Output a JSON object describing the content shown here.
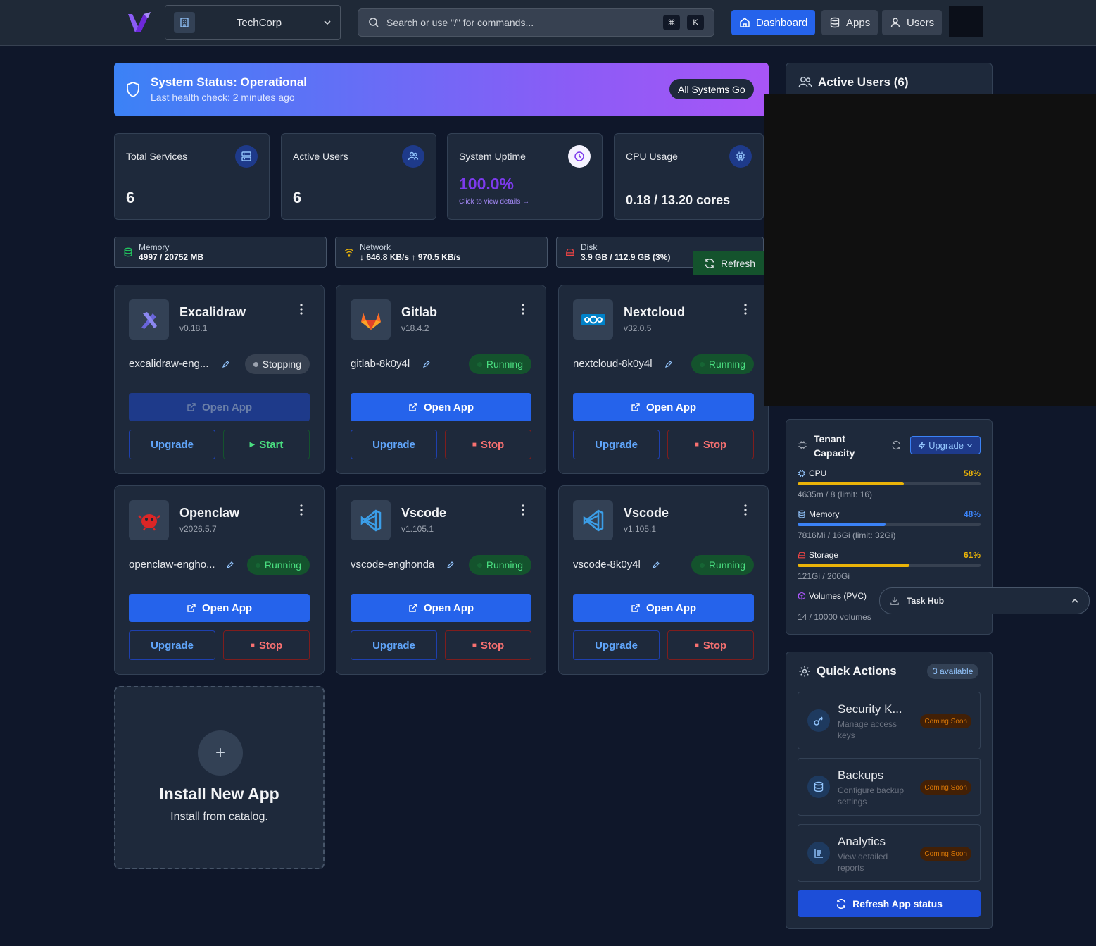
{
  "header": {
    "org_name": "TechCorp",
    "search_placeholder": "Search or use \"/\" for commands...",
    "shortcut_keys": [
      "⌘",
      "K"
    ],
    "nav": [
      {
        "label": "Dashboard",
        "icon": "home-icon",
        "active": true
      },
      {
        "label": "Apps",
        "icon": "database-icon",
        "active": false
      },
      {
        "label": "Users",
        "icon": "user-icon",
        "active": false
      }
    ]
  },
  "status_banner": {
    "title": "System Status: Operational",
    "subtitle": "Last health check: 2 minutes ago",
    "pill": "All Systems Go"
  },
  "stats": [
    {
      "label": "Total Services",
      "value": "6",
      "icon": "server-icon"
    },
    {
      "label": "Active Users",
      "value": "6",
      "icon": "users-icon"
    },
    {
      "label": "System Uptime",
      "value": "100.0%",
      "link": "Click to view details →",
      "icon": "clock-icon"
    },
    {
      "label": "CPU Usage",
      "value": "0.18 / 13.20 cores",
      "icon": "cpu-icon"
    }
  ],
  "metrics": [
    {
      "label": "Memory",
      "value": "4997 / 20752 MB",
      "icon": "memory-icon",
      "color": "#22c55e"
    },
    {
      "label": "Network",
      "value": "↓ 646.8 KB/s ↑ 970.5 KB/s",
      "icon": "wifi-icon",
      "color": "#eab308"
    },
    {
      "label": "Disk",
      "value": "3.9 GB / 112.9 GB (3%)",
      "icon": "disk-icon",
      "color": "#ef4444"
    }
  ],
  "refresh_label": "Refresh",
  "apps": [
    {
      "name": "Excalidraw",
      "version": "v0.18.1",
      "instance": "excalidraw-eng...",
      "status": "Stopping",
      "open_label": "Open App",
      "upgrade_label": "Upgrade",
      "action_label": "Start",
      "logo": "excalidraw-logo-icon"
    },
    {
      "name": "Gitlab",
      "version": "v18.4.2",
      "instance": "gitlab-8k0y4l",
      "status": "Running",
      "open_label": "Open App",
      "upgrade_label": "Upgrade",
      "action_label": "Stop",
      "logo": "gitlab-logo-icon"
    },
    {
      "name": "Nextcloud",
      "version": "v32.0.5",
      "instance": "nextcloud-8k0y4l",
      "status": "Running",
      "open_label": "Open App",
      "upgrade_label": "Upgrade",
      "action_label": "Stop",
      "logo": "nextcloud-logo-icon"
    },
    {
      "name": "Openclaw",
      "version": "v2026.5.7",
      "instance": "openclaw-engho...",
      "status": "Running",
      "open_label": "Open App",
      "upgrade_label": "Upgrade",
      "action_label": "Stop",
      "logo": "openclaw-logo-icon"
    },
    {
      "name": "Vscode",
      "version": "v1.105.1",
      "instance": "vscode-enghonda",
      "status": "Running",
      "open_label": "Open App",
      "upgrade_label": "Upgrade",
      "action_label": "Stop",
      "logo": "vscode-logo-icon"
    },
    {
      "name": "Vscode",
      "version": "v1.105.1",
      "instance": "vscode-8k0y4l",
      "status": "Running",
      "open_label": "Open App",
      "upgrade_label": "Upgrade",
      "action_label": "Stop",
      "logo": "vscode-logo-icon"
    }
  ],
  "install": {
    "title": "Install New App",
    "subtitle": "Install from catalog."
  },
  "active_users": {
    "title": "Active Users (6)"
  },
  "tenant_capacity": {
    "title": "Tenant Capacity",
    "upgrade_label": "Upgrade",
    "resources": [
      {
        "label": "CPU",
        "percent": "58%",
        "fraction": 0.58,
        "detail": "4635m / 8  (limit: 16)",
        "color": "#eab308",
        "icon": "cpu-icon"
      },
      {
        "label": "Memory",
        "percent": "48%",
        "fraction": 0.48,
        "detail": "7816Mi / 16Gi  (limit: 32Gi)",
        "color": "#3b82f6",
        "icon": "memory-icon"
      },
      {
        "label": "Storage",
        "percent": "61%",
        "fraction": 0.61,
        "detail": "121Gi / 200Gi",
        "color": "#eab308",
        "icon": "disk-icon"
      },
      {
        "label": "Volumes (PVC)",
        "detail": "14 / 10000 volumes",
        "icon": "cube-icon"
      }
    ]
  },
  "task_hub": {
    "label": "Task Hub"
  },
  "quick_actions": {
    "title": "Quick Actions",
    "count": "3 available",
    "items": [
      {
        "title": "Security K...",
        "desc": "Manage access keys",
        "badge": "Coming Soon",
        "icon": "key-icon"
      },
      {
        "title": "Backups",
        "desc": "Configure backup settings",
        "badge": "Coming Soon",
        "icon": "database-icon"
      },
      {
        "title": "Analytics",
        "desc": "View detailed reports",
        "badge": "Coming Soon",
        "icon": "report-icon"
      }
    ],
    "refresh_label": "Refresh App status"
  }
}
